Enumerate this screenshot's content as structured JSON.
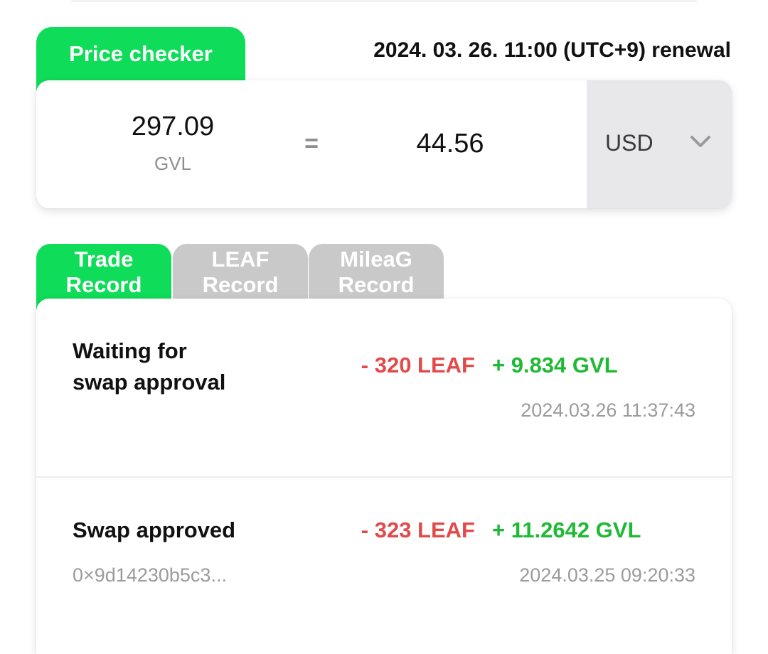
{
  "price_checker": {
    "tab_label": "Price checker",
    "renewal": "2024. 03. 26. 11:00 (UTC+9) renewal",
    "gvl_amount": "297.09",
    "gvl_unit": "GVL",
    "equals": "=",
    "converted_amount": "44.56",
    "currency": {
      "selected": "USD",
      "icon": "chevron-down-icon"
    }
  },
  "record_tabs": [
    {
      "label": "Trade\nRecord",
      "active": true
    },
    {
      "label": "LEAF\nRecord",
      "active": false
    },
    {
      "label": "MileaG\nRecord",
      "active": false
    }
  ],
  "records": [
    {
      "status": "Waiting for\nswap approval",
      "minus": "- 320 LEAF",
      "plus": "+ 9.834 GVL",
      "time": "2024.03.26 11:37:43"
    },
    {
      "status": "Swap approved",
      "minus": "- 323 LEAF",
      "plus": "+ 11.2642 GVL",
      "hash": "0×9d14230b5c3...",
      "time": "2024.03.25 09:20:33"
    }
  ],
  "colors": {
    "accent_green": "#0fdc58",
    "inactive_tab": "#c9c9c9",
    "negative": "#e24a4a",
    "positive": "#1fb935"
  }
}
